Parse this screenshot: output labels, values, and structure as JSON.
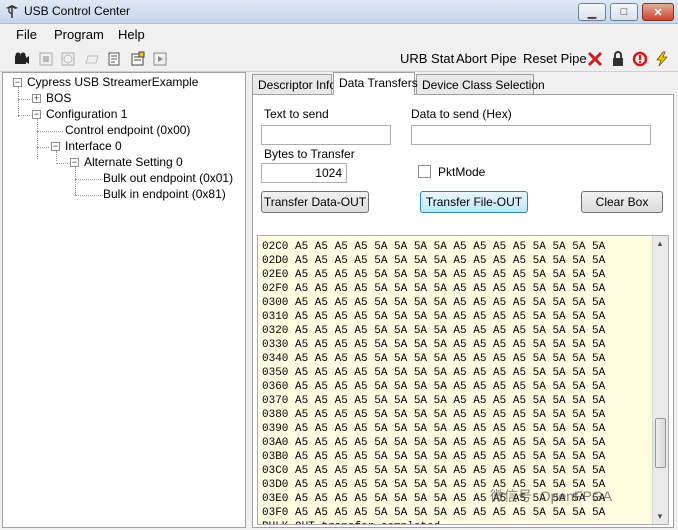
{
  "window": {
    "title": "USB Control Center",
    "minimize": "▁",
    "maximize": "□",
    "close": "✕"
  },
  "menu": {
    "items": [
      "File",
      "Program",
      "Help"
    ]
  },
  "toolbar": {
    "urb_stat": "URB Stat",
    "abort_pipe": "Abort Pipe",
    "reset_pipe": "Reset Pipe",
    "icons": [
      "camera-icon",
      "stop-icon",
      "clock-icon",
      "folder-icon",
      "open-file-icon",
      "play-icon",
      "red-x-icon",
      "lock-icon",
      "reset-icon",
      "lightning-icon"
    ]
  },
  "tree": {
    "root": "Cypress USB StreamerExample",
    "bos": "BOS",
    "config": "Configuration 1",
    "control_ep": "Control endpoint (0x00)",
    "interface": "Interface 0",
    "alt_setting": "Alternate Setting 0",
    "bulk_out": "Bulk out endpoint (0x01)",
    "bulk_in": "Bulk in endpoint (0x81)"
  },
  "tabs": {
    "descriptor": "Descriptor Info",
    "data_transfers": "Data Transfers",
    "device_class": "Device Class Selection"
  },
  "form": {
    "text_to_send_label": "Text to send",
    "data_to_send_label": "Data to send (Hex)",
    "text_to_send_value": "",
    "data_to_send_value": "",
    "bytes_label": "Bytes to Transfer",
    "bytes_value": "1024",
    "pktmode_label": "PktMode",
    "pktmode_checked": false,
    "transfer_data_out": "Transfer Data-OUT",
    "transfer_file_out": "Transfer File-OUT",
    "clear_box": "Clear Box"
  },
  "output": {
    "lines": [
      "02C0 A5 A5 A5 A5 5A 5A 5A 5A A5 A5 A5 A5 5A 5A 5A 5A",
      "02D0 A5 A5 A5 A5 5A 5A 5A 5A A5 A5 A5 A5 5A 5A 5A 5A",
      "02E0 A5 A5 A5 A5 5A 5A 5A 5A A5 A5 A5 A5 5A 5A 5A 5A",
      "02F0 A5 A5 A5 A5 5A 5A 5A 5A A5 A5 A5 A5 5A 5A 5A 5A",
      "0300 A5 A5 A5 A5 5A 5A 5A 5A A5 A5 A5 A5 5A 5A 5A 5A",
      "0310 A5 A5 A5 A5 5A 5A 5A 5A A5 A5 A5 A5 5A 5A 5A 5A",
      "0320 A5 A5 A5 A5 5A 5A 5A 5A A5 A5 A5 A5 5A 5A 5A 5A",
      "0330 A5 A5 A5 A5 5A 5A 5A 5A A5 A5 A5 A5 5A 5A 5A 5A",
      "0340 A5 A5 A5 A5 5A 5A 5A 5A A5 A5 A5 A5 5A 5A 5A 5A",
      "0350 A5 A5 A5 A5 5A 5A 5A 5A A5 A5 A5 A5 5A 5A 5A 5A",
      "0360 A5 A5 A5 A5 5A 5A 5A 5A A5 A5 A5 A5 5A 5A 5A 5A",
      "0370 A5 A5 A5 A5 5A 5A 5A 5A A5 A5 A5 A5 5A 5A 5A 5A",
      "0380 A5 A5 A5 A5 5A 5A 5A 5A A5 A5 A5 A5 5A 5A 5A 5A",
      "0390 A5 A5 A5 A5 5A 5A 5A 5A A5 A5 A5 A5 5A 5A 5A 5A",
      "03A0 A5 A5 A5 A5 5A 5A 5A 5A A5 A5 A5 A5 5A 5A 5A 5A",
      "03B0 A5 A5 A5 A5 5A 5A 5A 5A A5 A5 A5 A5 5A 5A 5A 5A",
      "03C0 A5 A5 A5 A5 5A 5A 5A 5A A5 A5 A5 A5 5A 5A 5A 5A",
      "03D0 A5 A5 A5 A5 5A 5A 5A 5A A5 A5 A5 A5 5A 5A 5A 5A",
      "03E0 A5 A5 A5 A5 5A 5A 5A 5A A5 A5 A5 A5 5A 5A 5A 5A",
      "03F0 A5 A5 A5 A5 5A 5A 5A 5A A5 A5 A5 A5 5A 5A 5A 5A",
      "BULK OUT transfer completed"
    ],
    "scroll_position": 0.8
  },
  "watermark": "微信号: OpenFPGA"
}
